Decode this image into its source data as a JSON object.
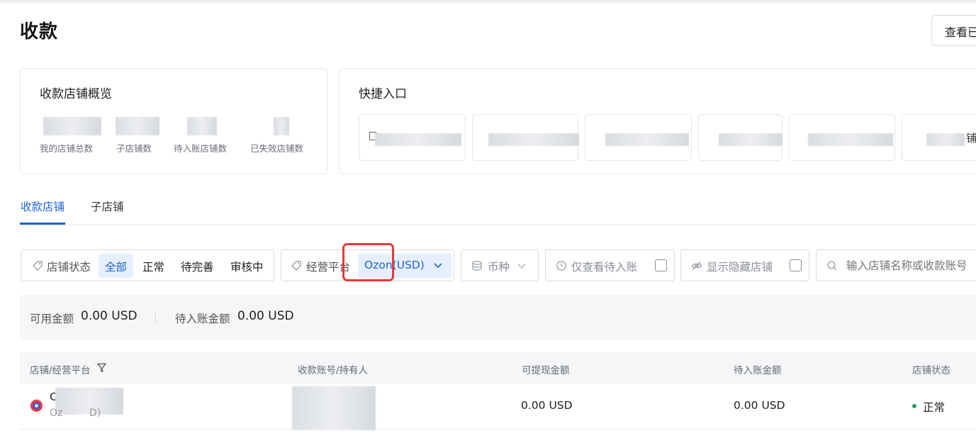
{
  "page": {
    "title": "收款",
    "view_button": "查看已"
  },
  "overview": {
    "title": "收款店铺概览",
    "stats": [
      {
        "label": "我的店铺总数"
      },
      {
        "label": "子店铺数"
      },
      {
        "label": "待入账店铺数"
      },
      {
        "label": "已失效店铺数"
      }
    ]
  },
  "quick_entry": {
    "title": "快捷入口",
    "tiles": [
      {
        "label_fragment": ""
      },
      {
        "label_fragment": ""
      },
      {
        "label_fragment": ""
      },
      {
        "label_fragment": ""
      },
      {
        "label_fragment": ""
      },
      {
        "label_fragment": ""
      }
    ],
    "last_tile_fragment": "铺"
  },
  "tabs": [
    {
      "label": "收款店铺",
      "active": true
    },
    {
      "label": "子店铺",
      "active": false
    }
  ],
  "filters": {
    "store_status": {
      "label": "店铺状态",
      "options": [
        {
          "label": "全部",
          "selected": true
        },
        {
          "label": "正常",
          "selected": false
        },
        {
          "label": "待完善",
          "selected": false
        },
        {
          "label": "审核中",
          "selected": false
        }
      ]
    },
    "platform": {
      "label": "经营平台",
      "selected": "Ozon(USD)"
    },
    "currency": {
      "label": "币种"
    },
    "pending_only": {
      "label": "仅查看待入账",
      "checked": false
    },
    "show_hidden": {
      "label": "显示隐藏店铺",
      "checked": false
    },
    "search": {
      "placeholder": "输入店铺名称或收款账号"
    }
  },
  "summary": {
    "available_label": "可用金额",
    "available_value": "0.00 USD",
    "pending_label": "待入账金额",
    "pending_value": "0.00 USD"
  },
  "table": {
    "columns": [
      "店铺/经营平台",
      "收款账号/持有人",
      "可提现金额",
      "待入账金额",
      "店铺状态"
    ],
    "rows": [
      {
        "store_name_fragment": "C",
        "platform_fragment_left": "Oz",
        "platform_fragment_right": "D)",
        "withdrawable": "0.00 USD",
        "pending": "0.00 USD",
        "status": "正常"
      }
    ]
  },
  "colors": {
    "accent": "#1f63d6",
    "highlight_box": "#e4393c",
    "status_ok": "#22a152",
    "summary_bg": "#f4f6f8"
  }
}
